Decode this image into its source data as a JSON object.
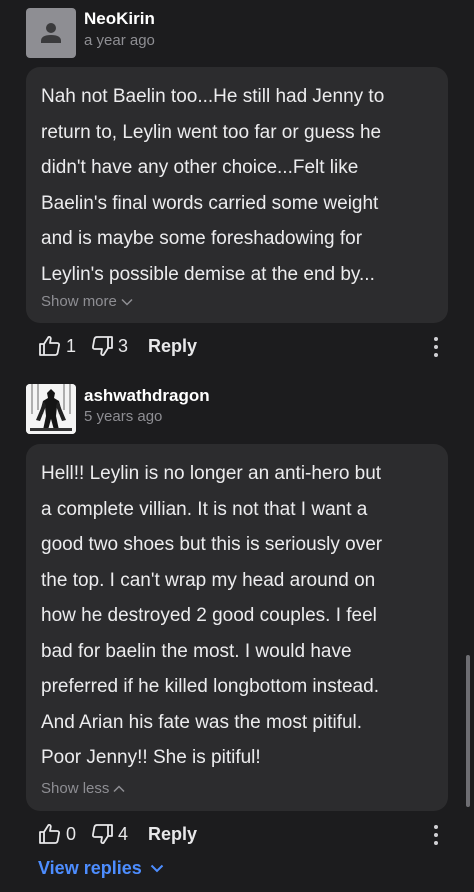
{
  "comments": [
    {
      "username": "NeoKirin",
      "time": "a year ago",
      "avatar_icon": "default-user-icon",
      "text": "Nah not Baelin too...He still had Jenny to\nreturn to, Leylin went too far or guess he\ndidn't have any other choice...Felt like\nBaelin's final words carried some weight\nand is maybe some foreshadowing for\nLeylin's possible demise at the end by...",
      "toggle_label": "Show more",
      "likes": "1",
      "dislikes": "3",
      "reply_label": "Reply"
    },
    {
      "username": "ashwathdragon",
      "time": "5 years ago",
      "avatar_icon": "dark-knight-avatar",
      "text": "Hell!! Leylin is no longer an anti-hero but\na complete villian. It is not that I want a\ngood two shoes but this is seriously over\nthe top. I can't wrap my head around on\nhow he destroyed 2 good couples. I feel\nbad for baelin the most. I would have\npreferred if he killed longbottom instead.\nAnd Arian his fate was the most pitiful.\nPoor Jenny!! She is pitiful!",
      "toggle_label": "Show less",
      "likes": "0",
      "dislikes": "4",
      "reply_label": "Reply"
    }
  ],
  "view_replies_label": "View replies",
  "colors": {
    "background": "#1c1c1e",
    "bubble": "#2c2c2e",
    "link": "#4d8dff",
    "muted": "#8e8e93"
  }
}
